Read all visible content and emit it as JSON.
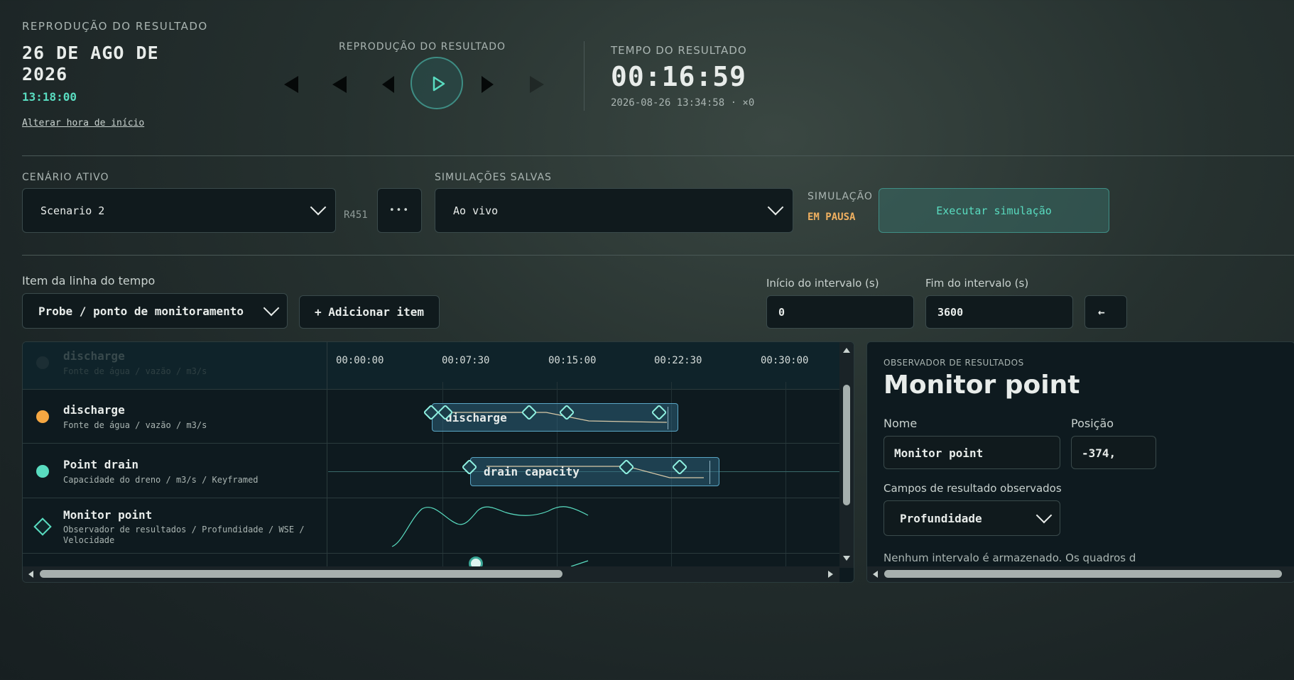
{
  "header": {
    "section_label": "REPRODUÇÃO DO RESULTADO",
    "date_line1": "26 DE AGO DE",
    "date_line2": "2026",
    "start_time": "13:18:00",
    "change_start_link": "Alterar hora de início",
    "playback_label": "REPRODUÇÃO DO RESULTADO",
    "result_time_label": "TEMPO DO RESULTADO",
    "result_time": "00:16:59",
    "result_timestamp": "2026-08-26 13:34:58 · ×0"
  },
  "scenario": {
    "label": "CENÁRIO ATIVO",
    "value": "Scenario 2",
    "revision": "R451",
    "more": "•••",
    "saved_label": "SIMULAÇÕES SALVAS",
    "saved_value": "Ao vivo",
    "sim_label": "SIMULAÇÃO",
    "sim_status": "EM PAUSA",
    "run_button": "Executar simulação"
  },
  "timeline_controls": {
    "item_label": "Item da linha do tempo",
    "item_value": "Probe / ponto de monitoramento",
    "add_button": "+ Adicionar item",
    "start_label": "Início do intervalo (s)",
    "start_value": "0",
    "end_label": "Fim do intervalo (s)",
    "end_value": "3600",
    "back_arrow": "←"
  },
  "timeline": {
    "ticks": [
      "00:00:00",
      "00:07:30",
      "00:15:00",
      "00:22:30",
      "00:30:00"
    ],
    "faded_header": {
      "name": "discharge",
      "sub": "Fonte de água / vazão / m3/s"
    },
    "rows": [
      {
        "name": "discharge",
        "sub": "Fonte de água / vazão / m3/s",
        "color": "#f5a742",
        "clip": "discharge"
      },
      {
        "name": "Point drain",
        "sub": "Capacidade do dreno / m3/s / Keyframed",
        "color": "#59dcc0",
        "clip": "drain capacity"
      },
      {
        "name": "Monitor point",
        "sub": "Observador de resultados / Profundidade / WSE /",
        "sub2": "Velocidade",
        "color": "#59dcc0"
      }
    ]
  },
  "observer": {
    "label": "OBSERVADOR DE RESULTADOS",
    "title": "Monitor point",
    "name_label": "Nome",
    "name_value": "Monitor point",
    "position_label": "Posição",
    "position_value": "-374,",
    "fields_label": "Campos de resultado observados",
    "fields_value": "Profundidade",
    "note": "Nenhum intervalo é armazenado. Os quadros d"
  }
}
